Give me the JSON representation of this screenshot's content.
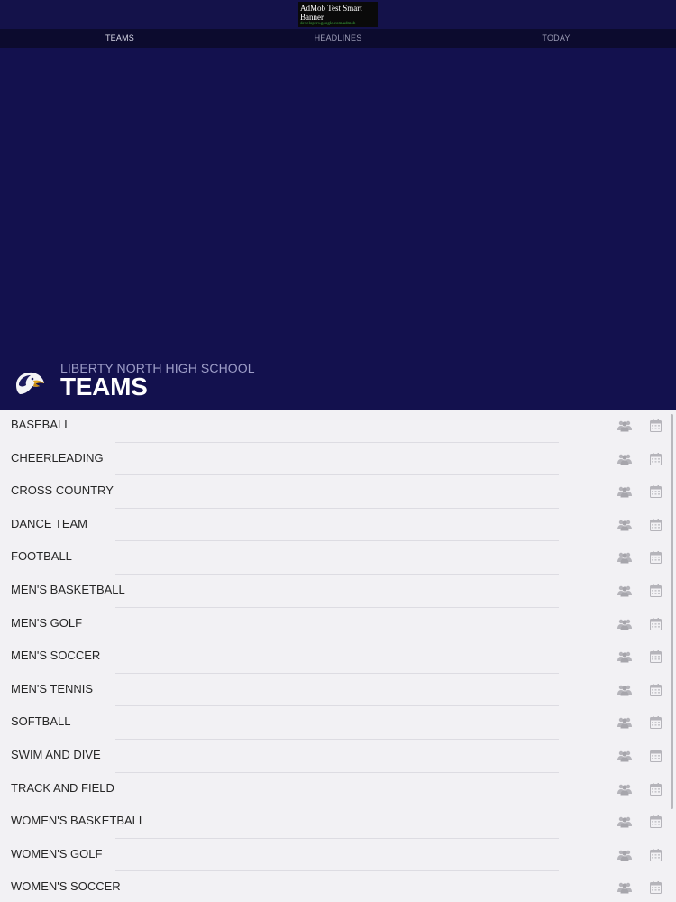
{
  "ad": {
    "title": "AdMob Test Smart Banner",
    "url": "developers.google.com/admob"
  },
  "tabs": [
    {
      "label": "TEAMS",
      "active": true
    },
    {
      "label": "HEADLINES",
      "active": false
    },
    {
      "label": "TODAY",
      "active": false
    }
  ],
  "header": {
    "school_name": "LIBERTY NORTH HIGH SCHOOL",
    "title": "TEAMS",
    "logo_icon": "eagle-logo-icon"
  },
  "colors": {
    "brand_navy": "#13114e",
    "tab_bar": "#0c0b2e",
    "list_bg": "#f2f1f4",
    "icon_gray": "#b5b4ba"
  },
  "teams": [
    {
      "name": "BASEBALL"
    },
    {
      "name": "CHEERLEADING"
    },
    {
      "name": "CROSS COUNTRY"
    },
    {
      "name": "DANCE TEAM"
    },
    {
      "name": "FOOTBALL"
    },
    {
      "name": "MEN'S BASKETBALL"
    },
    {
      "name": "MEN'S GOLF"
    },
    {
      "name": "MEN'S SOCCER"
    },
    {
      "name": "MEN'S TENNIS"
    },
    {
      "name": "SOFTBALL"
    },
    {
      "name": "SWIM AND DIVE"
    },
    {
      "name": "TRACK AND FIELD"
    },
    {
      "name": "WOMEN'S BASKETBALL"
    },
    {
      "name": "WOMEN'S GOLF"
    },
    {
      "name": "WOMEN'S SOCCER"
    }
  ],
  "row_icons": {
    "roster": "team-roster-icon",
    "schedule": "calendar-icon"
  }
}
